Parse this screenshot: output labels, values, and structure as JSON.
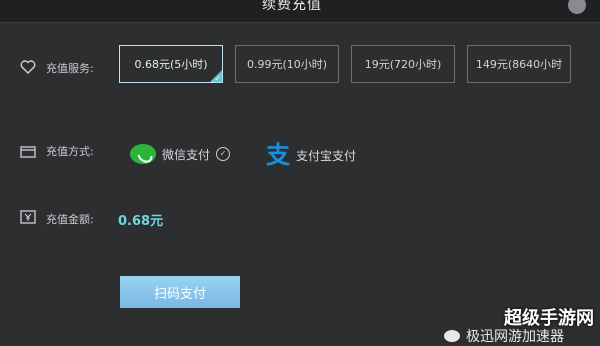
{
  "window": {
    "title": "续费充值"
  },
  "services": {
    "label": "充值服务:",
    "options": [
      {
        "label": "0.68元(5小时)",
        "selected": true
      },
      {
        "label": "0.99元(10小时)",
        "selected": false
      },
      {
        "label": "19元(720小时)",
        "selected": false
      },
      {
        "label": "149元(8640小时",
        "selected": false
      }
    ]
  },
  "methods": {
    "label": "充值方式:",
    "wechat": "微信支付",
    "alipay": "支付宝支付",
    "alipay_glyph": "支"
  },
  "amount": {
    "label": "充值金额:",
    "value": "0.68元"
  },
  "actions": {
    "scan_pay": "扫码支付"
  },
  "watermark": {
    "text": "超级手游网",
    "sub": "极迅网游加速器"
  },
  "colors": {
    "accent": "#6fd6df",
    "wechat": "#2bb43a",
    "alipay": "#1a8fe0"
  }
}
